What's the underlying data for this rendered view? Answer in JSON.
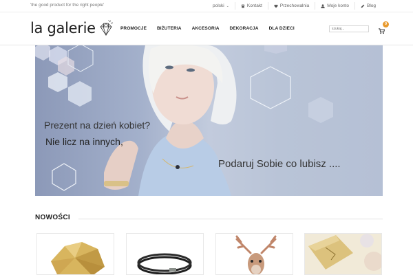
{
  "topbar": {
    "tagline": "'the good product for the right people'",
    "links": [
      {
        "label": "polski",
        "icon": "chevron-down-icon"
      },
      {
        "label": "Kontakt",
        "icon": "phone-icon"
      },
      {
        "label": "Przechowalnia",
        "icon": "heart-icon"
      },
      {
        "label": "Moje konto",
        "icon": "user-icon"
      },
      {
        "label": "Blog",
        "icon": "pencil-icon"
      }
    ]
  },
  "header": {
    "logo_text": "la galerie",
    "nav": [
      "PROMOCJE",
      "BIŻUTERIA",
      "AKCESORIA",
      "DEKORACJA",
      "DLA DZIECI"
    ],
    "search_placeholder": "szukaj...",
    "cart_count": "0"
  },
  "hero": {
    "line1": "Prezent na dzień kobiet?",
    "line2": "Nie licz na innych,",
    "line3": "Podaruj Sobie co lubisz ...."
  },
  "section": {
    "title": "NOWOŚCI"
  },
  "products": [
    {
      "name": "gold-geometric-bangle"
    },
    {
      "name": "black-leather-bracelet"
    },
    {
      "name": "deer-head-decoration"
    },
    {
      "name": "gold-pendant-card"
    }
  ],
  "colors": {
    "accent": "#e89a2e",
    "hero_bg": "#a3b0cb"
  }
}
